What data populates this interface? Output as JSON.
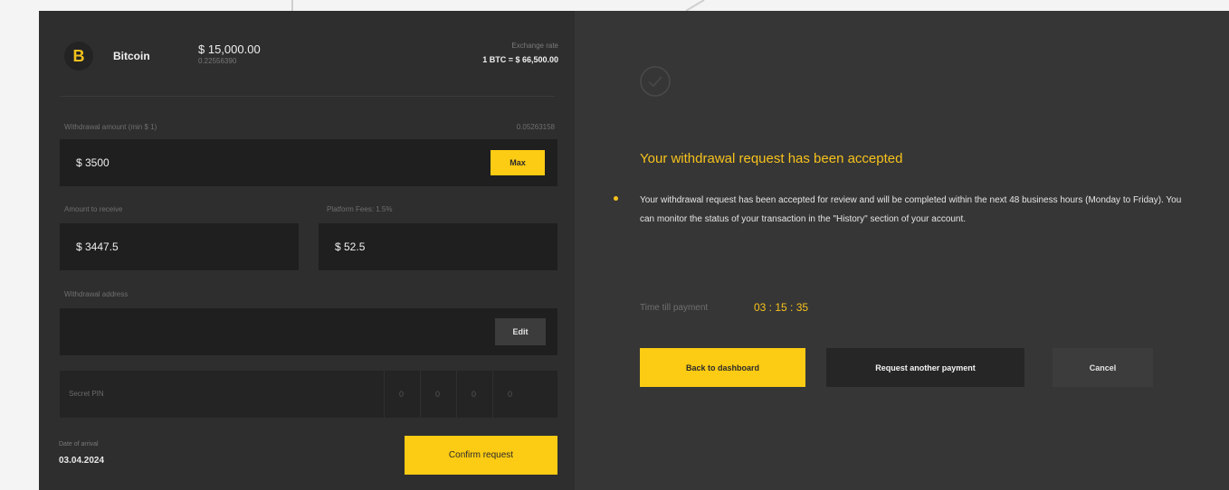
{
  "asset": {
    "icon": "bitcoin-icon",
    "icon_glyph": "B",
    "name": "Bitcoin",
    "balance": "$ 15,000.00",
    "balance_sub": "0.22556390",
    "rate_label": "Exchange rate",
    "rate_value": "1 BTC = $ 66,500.00"
  },
  "form": {
    "withdrawal_label": "Withdrawal amount (min $ 1)",
    "withdrawal_btc": "0.05263158",
    "withdrawal_value": "$ 3500",
    "max_label": "Max",
    "receive_label": "Amount to receive",
    "receive_value": "$ 3447.5",
    "fees_label": "Platform Fees: 1.5%",
    "fees_value": "$ 52.5",
    "address_label": "Withdrawal address",
    "address_value": "",
    "edit_label": "Edit",
    "pin_label": "Secret PIN",
    "pin_digits": [
      "0",
      "0",
      "0",
      "0"
    ],
    "date_label": "Date of arrival",
    "date_value": "03.04.2024",
    "confirm_label": "Confirm request"
  },
  "status": {
    "icon": "check-circle-icon",
    "title": "Your withdrawal request has been accepted",
    "description": "Your withdrawal request has been accepted for review and will be completed within the next 48 business hours (Monday to Friday). You can monitor the status of your transaction in the \"History\" section of your account.",
    "timer_label": "Time till payment",
    "timer_value": "03 : 15 : 35",
    "back_label": "Back to dashboard",
    "another_label": "Request another payment",
    "cancel_label": "Cancel"
  },
  "colors": {
    "accent": "#fccb13",
    "panel_left": "#2e2e2e",
    "panel_right": "#363636",
    "input_bg": "#1f1f1f"
  }
}
